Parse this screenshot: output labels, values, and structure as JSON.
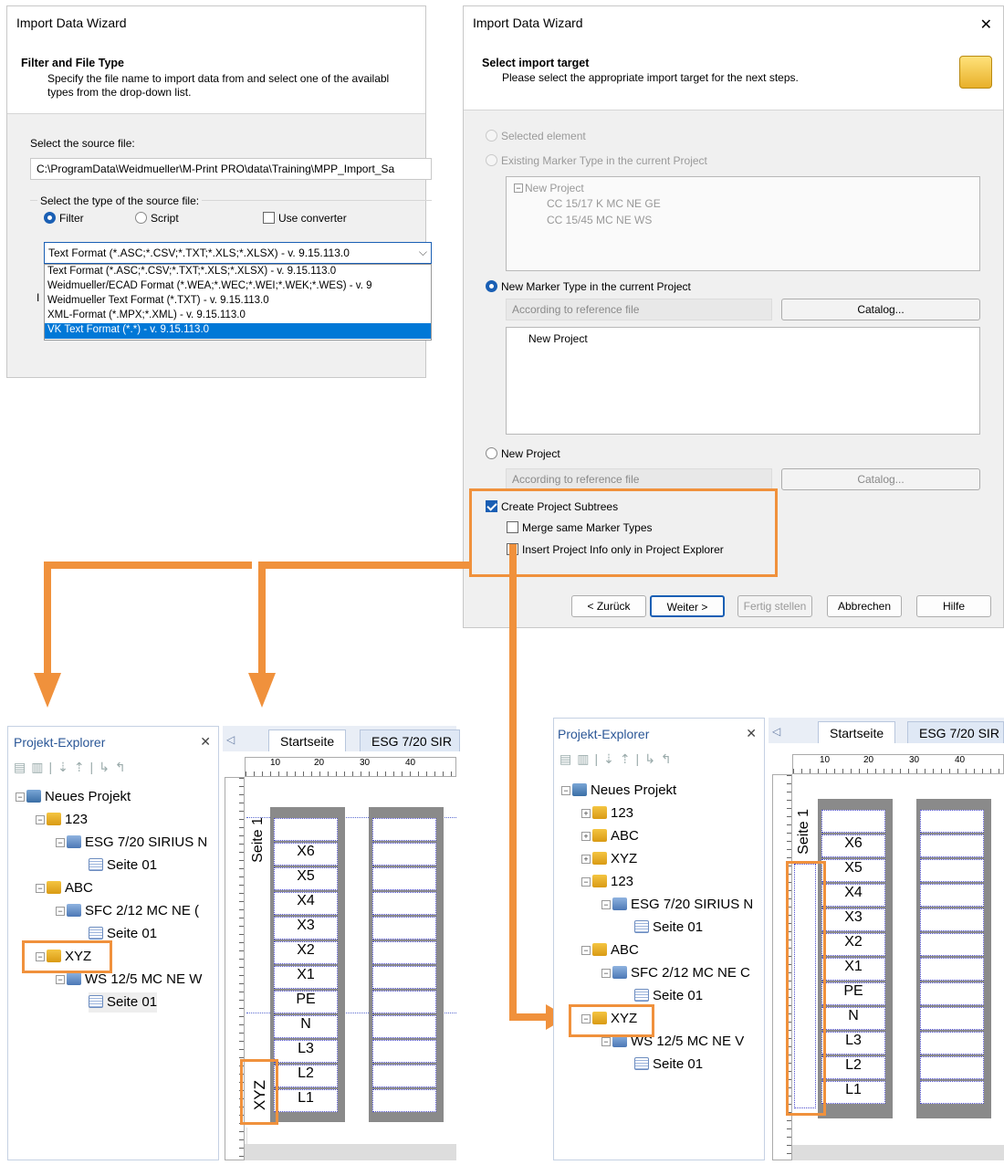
{
  "dialog1": {
    "title": "Import Data Wizard",
    "header_title": "Filter and File Type",
    "header_desc_1": "Specify the file name to import data from and select one of the availabl",
    "header_desc_2": "types from the drop-down list.",
    "source_label": "Select the source file:",
    "source_value": "C:\\ProgramData\\Weidmueller\\M-Print PRO\\data\\Training\\MPP_Import_Sa",
    "type_group_label": "Select the type of the source file:",
    "radio_filter": "Filter",
    "radio_script": "Script",
    "use_converter": "Use converter",
    "selected_format": "Text Format (*.ASC;*.CSV;*.TXT;*.XLS;*.XLSX) - v. 9.15.113.0",
    "options": [
      "Text Format (*.ASC;*.CSV;*.TXT;*.XLS;*.XLSX) - v. 9.15.113.0",
      "Weidmueller/ECAD Format (*.WEA;*.WEC;*.WEI;*.WEK;*.WES) - v. 9",
      "Weidmueller Text Format (*.TXT) - v. 9.15.113.0",
      "XML-Format (*.MPX;*.XML) - v. 9.15.113.0",
      "VK Text Format (*.*) - v. 9.15.113.0"
    ],
    "side_letter": "I"
  },
  "dialog2": {
    "title": "Import Data Wizard",
    "close": "✕",
    "header_title": "Select import target",
    "header_desc": "Please select the appropriate import target for the next steps.",
    "opt_selected": "Selected element",
    "opt_existing": "Existing Marker Type in the current Project",
    "tree1": [
      "New Project",
      "CC 15/17 K MC NE GE",
      "CC 15/45 MC NE WS"
    ],
    "opt_new_marker": "New Marker Type in the current Project",
    "ref_placeholder": "According to reference file",
    "catalog": "Catalog...",
    "tree2": [
      "New Project"
    ],
    "opt_new_project": "New Project",
    "create_subtrees": "Create Project Subtrees",
    "merge": "Merge same Marker Types",
    "insert_info": "Insert Project Info only in Project Explorer",
    "btn_back": "< Zurück",
    "btn_next": "Weiter >",
    "btn_finish": "Fertig stellen",
    "btn_cancel": "Abbrechen",
    "btn_help": "Hilfe"
  },
  "left_panel": {
    "explorer_title": "Projekt-Explorer",
    "close": "✕",
    "tabs": [
      "Startseite",
      "ESG 7/20 SIR"
    ],
    "tree": [
      "Neues Projekt",
      "123",
      "ESG 7/20 SIRIUS N",
      "Seite 01",
      "ABC",
      "SFC 2/12 MC NE (",
      "Seite 01",
      "XYZ",
      "WS 12/5 MC NE W",
      "Seite 01"
    ],
    "ruler": [
      "10",
      "20",
      "30",
      "40"
    ],
    "page_label": "Seite 1",
    "side_label": "XYZ",
    "cells": [
      "X6",
      "X5",
      "X4",
      "X3",
      "X2",
      "X1",
      "PE",
      "N",
      "L3",
      "L2",
      "L1"
    ]
  },
  "right_panel": {
    "explorer_title": "Projekt-Explorer",
    "close": "✕",
    "tabs": [
      "Startseite",
      "ESG 7/20 SIR"
    ],
    "tree": [
      "Neues Projekt",
      "123",
      "ABC",
      "XYZ",
      "123",
      "ESG 7/20 SIRIUS N",
      "Seite 01",
      "ABC",
      "SFC 2/12 MC NE C",
      "Seite 01",
      "XYZ",
      "WS 12/5 MC NE V",
      "Seite 01"
    ],
    "ruler": [
      "10",
      "20",
      "30",
      "40"
    ],
    "page_label": "Seite 1",
    "cells": [
      "X6",
      "X5",
      "X4",
      "X3",
      "X2",
      "X1",
      "PE",
      "N",
      "L3",
      "L2",
      "L1"
    ]
  },
  "colors": {
    "highlight": "#f0913c",
    "selection": "#0078d7"
  }
}
